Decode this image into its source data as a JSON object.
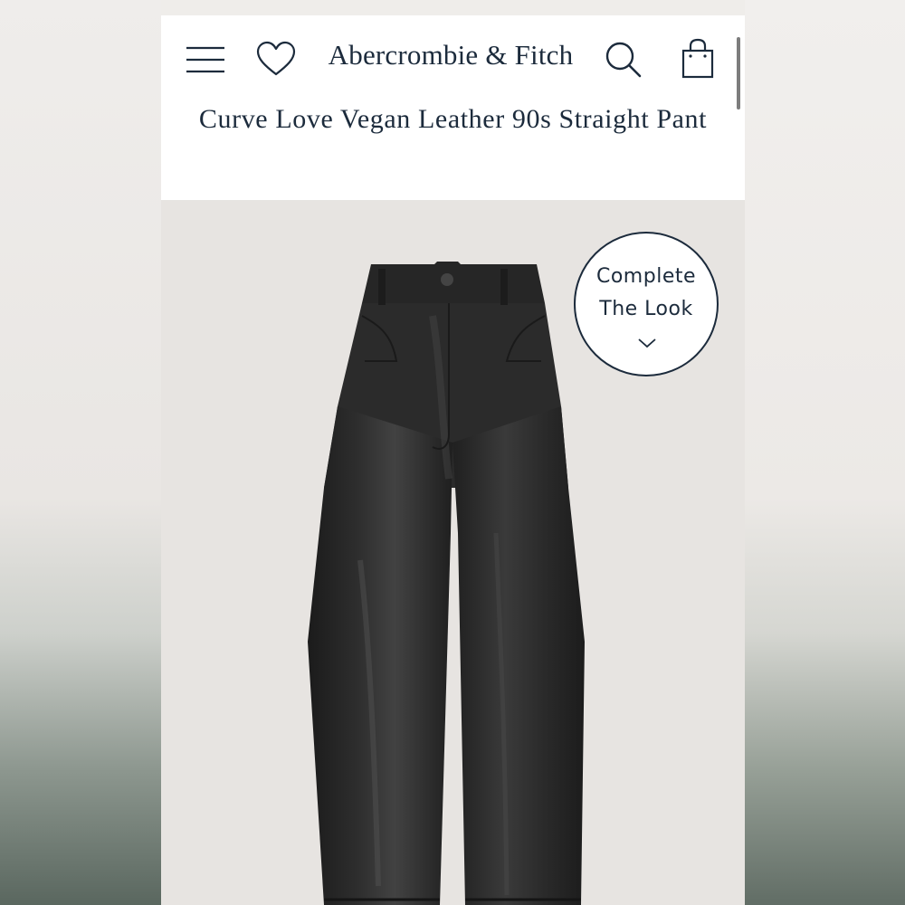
{
  "header": {
    "brand": "Abercrombie & Fitch",
    "icons": [
      "menu-icon",
      "heart-icon",
      "search-icon",
      "bag-icon"
    ]
  },
  "product": {
    "title": "Curve Love Vegan Leather 90s Straight Pant"
  },
  "complete_the_look": {
    "label_line1": "Complete",
    "label_line2": "The Look",
    "icon": "chevron-down-icon"
  },
  "colors": {
    "navy": "#1c2b3c",
    "header_bg": "#ffffff",
    "photo_bg": "#e7e4e1",
    "product_black": "#232323"
  }
}
